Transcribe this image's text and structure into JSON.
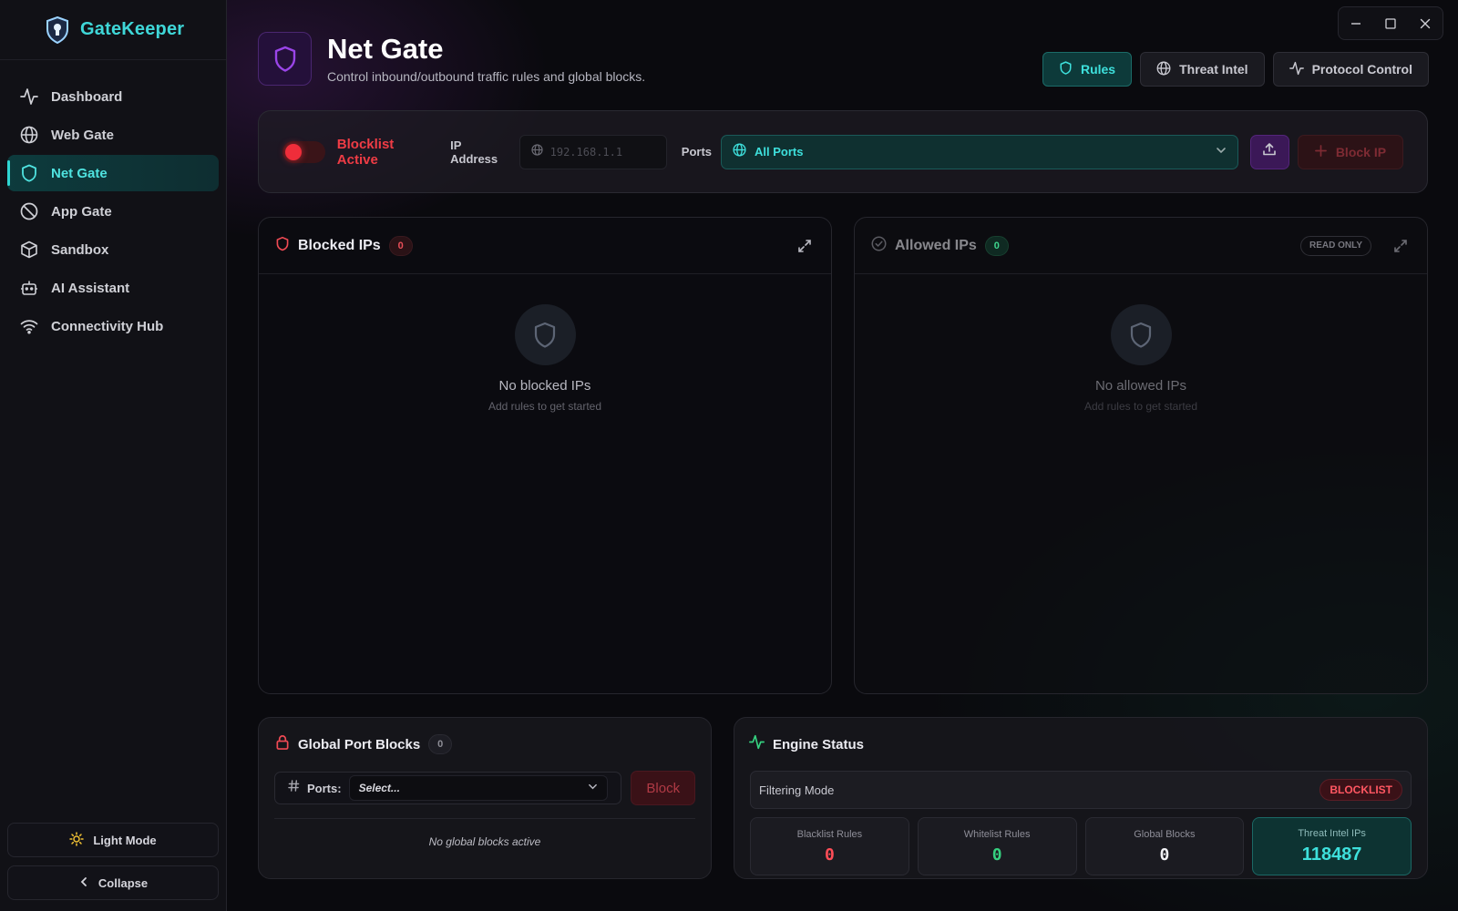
{
  "app": {
    "name": "GateKeeper"
  },
  "sidebar": {
    "items": [
      {
        "label": "Dashboard",
        "icon": "activity-icon"
      },
      {
        "label": "Web Gate",
        "icon": "globe-icon"
      },
      {
        "label": "Net Gate",
        "icon": "shield-icon",
        "active": true
      },
      {
        "label": "App Gate",
        "icon": "ban-icon"
      },
      {
        "label": "Sandbox",
        "icon": "box-icon"
      },
      {
        "label": "AI Assistant",
        "icon": "bot-icon"
      },
      {
        "label": "Connectivity Hub",
        "icon": "wifi-icon"
      }
    ],
    "light_mode_label": "Light Mode",
    "collapse_label": "Collapse"
  },
  "header": {
    "title": "Net Gate",
    "subtitle": "Control inbound/outbound traffic rules and global blocks.",
    "tabs": [
      {
        "label": "Rules",
        "active": true
      },
      {
        "label": "Threat Intel"
      },
      {
        "label": "Protocol Control"
      }
    ]
  },
  "controls": {
    "blocklist_label": "Blocklist Active",
    "blocklist_on": true,
    "ip_label": "IP Address",
    "ip_placeholder": "192.168.1.1",
    "ports_label": "Ports",
    "ports_value": "All Ports",
    "block_ip_label": "Block IP"
  },
  "blocked_panel": {
    "title": "Blocked IPs",
    "count": "0",
    "empty_title": "No blocked IPs",
    "empty_sub": "Add rules to get started"
  },
  "allowed_panel": {
    "title": "Allowed IPs",
    "count": "0",
    "badge": "READ ONLY",
    "empty_title": "No allowed IPs",
    "empty_sub": "Add rules to get started"
  },
  "port_blocks": {
    "title": "Global Port Blocks",
    "count": "0",
    "ports_label": "Ports:",
    "select_placeholder": "Select...",
    "block_label": "Block",
    "empty": "No global blocks active"
  },
  "engine": {
    "title": "Engine Status",
    "mode_label": "Filtering Mode",
    "mode_value": "BLOCKLIST",
    "stats": [
      {
        "label": "Blacklist Rules",
        "value": "0",
        "color": "#ff4d57"
      },
      {
        "label": "Whitelist Rules",
        "value": "0",
        "color": "#35d07f"
      },
      {
        "label": "Global Blocks",
        "value": "0",
        "color": "#f2f2f5"
      },
      {
        "label": "Threat Intel IPs",
        "value": "118487",
        "color": "#3ee0dc"
      }
    ]
  },
  "colors": {
    "accent": "#2fd5d2",
    "danger": "#ef2d3a",
    "purple": "#7b2fbe"
  }
}
